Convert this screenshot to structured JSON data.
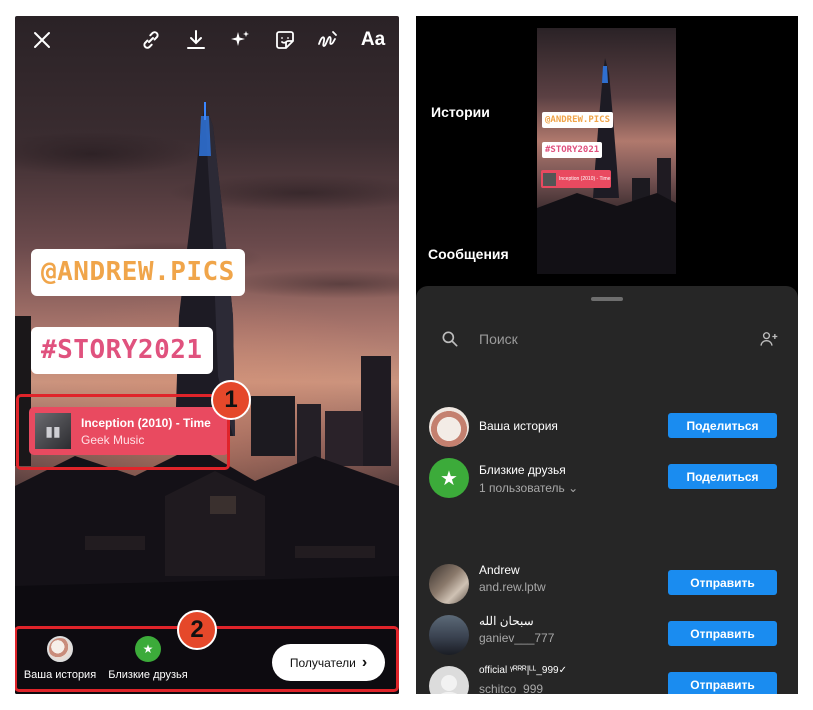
{
  "left": {
    "toolbar": {
      "close_icon": "close-icon",
      "link_icon": "link-icon",
      "download_icon": "download-icon",
      "effects_icon": "sparkles-icon",
      "sticker_icon": "sticker-icon",
      "draw_icon": "draw-icon",
      "text_label": "Aa"
    },
    "stickers": {
      "mention": "@ANDREW.PICS",
      "hashtag": "#STORY2021"
    },
    "music": {
      "title": "Inception (2010) - Time",
      "artist": "Geek Music"
    },
    "badges": [
      "1",
      "2"
    ],
    "bottom": {
      "your_story": "Ваша история",
      "close_friends": "Близкие друзья",
      "recipients": "Получатели"
    }
  },
  "right": {
    "preview": {
      "mention": "@ANDREW.PICS",
      "hashtag": "#STORY2021"
    },
    "search": {
      "placeholder": "Поиск"
    },
    "stories_title": "Истории",
    "messages_title": "Сообщения",
    "stories": [
      {
        "name": "Ваша история",
        "sub": "",
        "action": "Поделиться"
      },
      {
        "name": "Близкие друзья",
        "sub": "1 пользователь",
        "action": "Поделиться"
      }
    ],
    "messages": [
      {
        "name": "Andrew",
        "sub": "and.rew.lptw",
        "action": "Отправить"
      },
      {
        "name": "سبحان الله",
        "sub": "ganiev___777",
        "action": "Отправить"
      },
      {
        "name": "official ᵞᴿᴿᴿ|ᴸᴸ_999✓",
        "sub": "schitco_999",
        "action": "Отправить"
      }
    ]
  },
  "colors": {
    "accent_blue": "#1a8cf0",
    "music_red": "#e94a60",
    "mention_orange": "#f0a54a",
    "hashtag_pink": "#e0527e",
    "annotation_red": "#e0242a"
  }
}
